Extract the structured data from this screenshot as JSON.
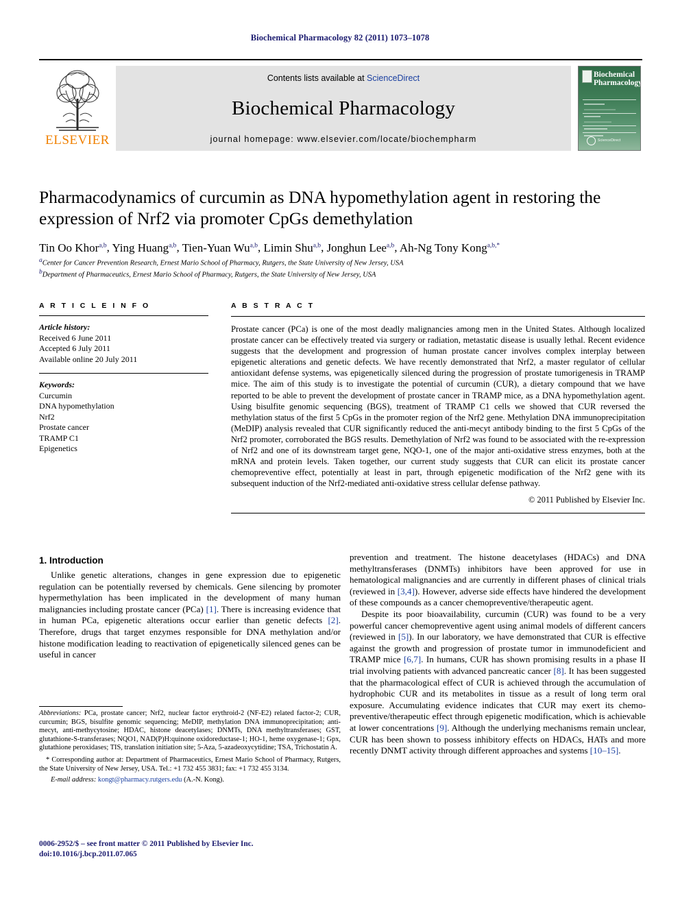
{
  "running_head": "Biochemical Pharmacology 82 (2011) 1073–1078",
  "masthead": {
    "publisher": "ELSEVIER",
    "contents_prefix": "Contents lists available at ",
    "contents_link": "ScienceDirect",
    "journal_name": "Biochemical Pharmacology",
    "homepage": "journal homepage: www.elsevier.com/locate/biochempharm",
    "cover_title_line1": "Biochemical",
    "cover_title_line2": "Pharmacology",
    "cover_footer": "ScienceDirect"
  },
  "article": {
    "title": "Pharmacodynamics of curcumin as DNA hypomethylation agent in restoring the expression of Nrf2 via promoter CpGs demethylation",
    "authors": [
      {
        "name": "Tin Oo Khor",
        "sup": "a,b"
      },
      {
        "name": "Ying Huang",
        "sup": "a,b"
      },
      {
        "name": "Tien-Yuan Wu",
        "sup": "a,b"
      },
      {
        "name": "Limin Shu",
        "sup": "a,b"
      },
      {
        "name": "Jonghun Lee",
        "sup": "a,b"
      },
      {
        "name": "Ah-Ng Tony Kong",
        "sup": "a,b,*"
      }
    ],
    "affiliations": [
      {
        "sup": "a",
        "text": "Center for Cancer Prevention Research, Ernest Mario School of Pharmacy, Rutgers, the State University of New Jersey, USA"
      },
      {
        "sup": "b",
        "text": "Department of Pharmaceutics, Ernest Mario School of Pharmacy, Rutgers, the State University of New Jersey, USA"
      }
    ]
  },
  "article_info": {
    "heading": "A R T I C L E   I N F O",
    "history_label": "Article history:",
    "history": [
      "Received 6 June 2011",
      "Accepted 6 July 2011",
      "Available online 20 July 2011"
    ],
    "keywords_label": "Keywords:",
    "keywords": [
      "Curcumin",
      "DNA hypomethylation",
      "Nrf2",
      "Prostate cancer",
      "TRAMP C1",
      "Epigenetics"
    ]
  },
  "abstract": {
    "heading": "A B S T R A C T",
    "text": "Prostate cancer (PCa) is one of the most deadly malignancies among men in the United States. Although localized prostate cancer can be effectively treated via surgery or radiation, metastatic disease is usually lethal. Recent evidence suggests that the development and progression of human prostate cancer involves complex interplay between epigenetic alterations and genetic defects. We have recently demonstrated that Nrf2, a master regulator of cellular antioxidant defense systems, was epigenetically silenced during the progression of prostate tumorigenesis in TRAMP mice. The aim of this study is to investigate the potential of curcumin (CUR), a dietary compound that we have reported to be able to prevent the development of prostate cancer in TRAMP mice, as a DNA hypomethylation agent. Using bisulfite genomic sequencing (BGS), treatment of TRAMP C1 cells we showed that CUR reversed the methylation status of the first 5 CpGs in the promoter region of the Nrf2 gene. Methylation DNA immunoprecipitation (MeDIP) analysis revealed that CUR significantly reduced the anti-mecyt antibody binding to the first 5 CpGs of the Nrf2 promoter, corroborated the BGS results. Demethylation of Nrf2 was found to be associated with the re-expression of Nrf2 and one of its downstream target gene, NQO-1, one of the major anti-oxidative stress enzymes, both at the mRNA and protein levels. Taken together, our current study suggests that CUR can elicit its prostate cancer chemopreventive effect, potentially at least in part, through epigenetic modification of the Nrf2 gene with its subsequent induction of the Nrf2-mediated anti-oxidative stress cellular defense pathway.",
    "copyright": "© 2011 Published by Elsevier Inc."
  },
  "introduction": {
    "heading": "1. Introduction",
    "left_paragraph_1_a": "Unlike genetic alterations, changes in gene expression due to epigenetic regulation can be potentially reversed by chemicals. Gene silencing by promoter hypermethylation has been implicated in the development of many human malignancies including prostate cancer (PCa) ",
    "left_ref_1": "[1]",
    "left_paragraph_1_b": ". There is increasing evidence that in human PCa, epigenetic alterations occur earlier than genetic defects ",
    "left_ref_2": "[2]",
    "left_paragraph_1_c": ". Therefore, drugs that target enzymes responsible for DNA methylation and/or histone modification leading to reactivation of epigenetically silenced genes can be useful in cancer",
    "right_paragraph_1_a": "prevention and treatment. The histone deacetylases (HDACs) and DNA methyltransferases (DNMTs) inhibitors have been approved for use in hematological malignancies and are currently in different phases of clinical trials (reviewed in ",
    "right_ref_34": "[3,4]",
    "right_paragraph_1_b": "). However, adverse side effects have hindered the development of these compounds as a cancer chemopreventive/therapeutic agent.",
    "right_paragraph_2_a": "Despite its poor bioavailability, curcumin (CUR) was found to be a very powerful cancer chemopreventive agent using animal models of different cancers (reviewed in ",
    "right_ref_5": "[5]",
    "right_paragraph_2_b": "). In our laboratory, we have demonstrated that CUR is effective against the growth and progression of prostate tumor in immunodeficient and TRAMP mice ",
    "right_ref_67": "[6,7]",
    "right_paragraph_2_c": ". In humans, CUR has shown promising results in a phase II trial involving patients with advanced pancreatic cancer ",
    "right_ref_8": "[8]",
    "right_paragraph_2_d": ". It has been suggested that the pharmacological effect of CUR is achieved through the accumulation of hydrophobic CUR and its metabolites in tissue as a result of long term oral exposure. Accumulating evidence indicates that CUR may exert its chemo-preventive/therapeutic effect through epigenetic modification, which is achievable at lower concentrations ",
    "right_ref_9": "[9]",
    "right_paragraph_2_e": ". Although the underlying mechanisms remain unclear, CUR has been shown to possess inhibitory effects on HDACs, HATs and more recently DNMT activity through different approaches and systems ",
    "right_ref_1015": "[10–15]",
    "right_paragraph_2_f": "."
  },
  "footnotes": {
    "abbreviations_label": "Abbreviations:",
    "abbreviations_text": " PCa, prostate cancer; Nrf2, nuclear factor erythroid-2 (NF-E2) related factor-2; CUR, curcumin; BGS, bisulfite genomic sequencing; MeDIP, methylation DNA immunoprecipitation; anti-mecyt, anti-methycytosine; HDAC, histone deacetylases; DNMTs, DNA methyltransferases; GST, glutathione-S-transferases; NQO1, NAD(P)H:quinone oxidoreductase-1; HO-1, heme oxygenase-1; Gpx, glutathione peroxidases; TIS, translation initiation site; 5-Aza, 5-azadeoxycytidine; TSA, Trichostatin A.",
    "corresponding_marker": "*",
    "corresponding_text": " Corresponding author at: Department of Pharmaceutics, Ernest Mario School of Pharmacy, Rutgers, the State University of New Jersey, USA. Tel.: +1 732 455 3831; fax: +1 732 455 3134.",
    "email_label": "E-mail address:",
    "email": "kongt@pharmacy.rutgers.edu",
    "email_attrib": " (A.-N. Kong).",
    "issn_line": "0006-2952/$ – see front matter © 2011 Published by Elsevier Inc.",
    "doi_line": "doi:10.1016/j.bcp.2011.07.065"
  },
  "colors": {
    "link_blue": "#1a3fa0",
    "head_navy": "#1b1b6f",
    "elsevier_orange": "#f08000",
    "mast_gray": "#e3e3e3",
    "cover_green": "#3f7a52"
  }
}
